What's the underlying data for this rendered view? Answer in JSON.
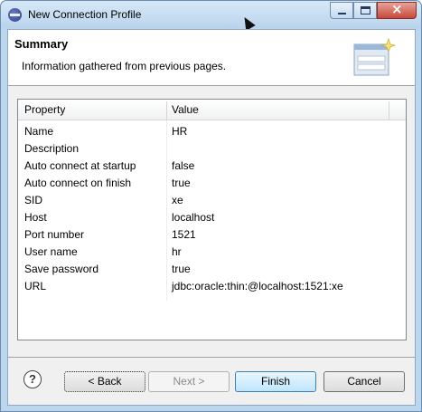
{
  "window": {
    "title": "New Connection Profile"
  },
  "header": {
    "title": "Summary",
    "description": "Information gathered from previous pages."
  },
  "table": {
    "columns": [
      "Property",
      "Value"
    ],
    "rows": [
      {
        "property": "Name",
        "value": "HR"
      },
      {
        "property": "Description",
        "value": ""
      },
      {
        "property": "Auto connect at startup",
        "value": "false"
      },
      {
        "property": "Auto connect on finish",
        "value": "true"
      },
      {
        "property": "SID",
        "value": "xe"
      },
      {
        "property": "Host",
        "value": "localhost"
      },
      {
        "property": "Port number",
        "value": "1521"
      },
      {
        "property": "User name",
        "value": "hr"
      },
      {
        "property": "Save password",
        "value": "true"
      },
      {
        "property": "URL",
        "value": "jdbc:oracle:thin:@localhost:1521:xe"
      }
    ]
  },
  "buttons": {
    "help": "?",
    "back": "< Back",
    "next": "Next >",
    "finish": "Finish",
    "cancel": "Cancel"
  }
}
